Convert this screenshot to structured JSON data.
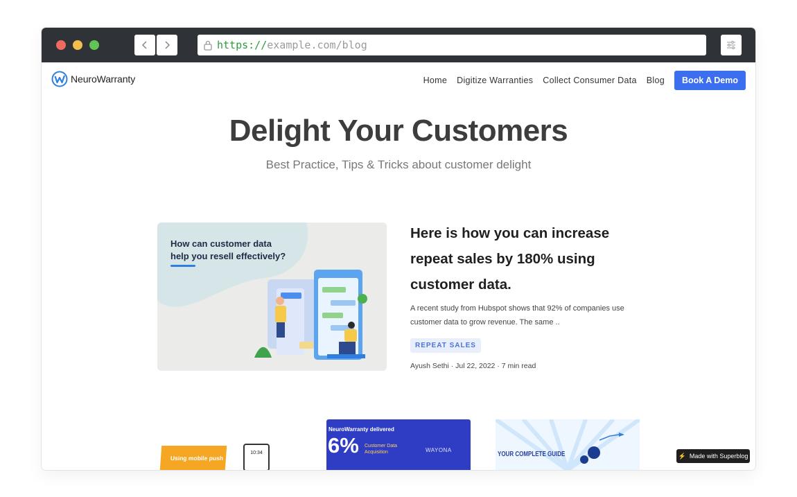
{
  "browser": {
    "url_scheme": "https://",
    "url_rest": "example.com/blog"
  },
  "header": {
    "logo_text": "NeuroWarranty",
    "nav": [
      "Home",
      "Digitize Warranties",
      "Collect Consumer Data",
      "Blog"
    ],
    "cta_label": "Book A Demo"
  },
  "hero": {
    "title": "Delight Your Customers",
    "subtitle": "Best Practice, Tips & Tricks about customer delight"
  },
  "featured_post": {
    "image_text_line1": "How can customer data",
    "image_text_line2": "help you resell effectively?",
    "title": "Here is how you can increase repeat sales by 180% using customer data.",
    "excerpt": "A recent study from Hubspot shows that 92% of companies use customer data to grow revenue. The same ..",
    "tag": "REPEAT SALES",
    "meta": "Ayush Sethi · Jul 22, 2022 · 7 min read"
  },
  "cards": [
    {
      "banner_text": "Using mobile push",
      "phone_time": "10:34"
    },
    {
      "headline": "NeuroWarranty delivered",
      "big_value": "6%",
      "sub_text": "Customer Data Acquisition",
      "brand": "WAYONA"
    },
    {
      "headline": "YOUR COMPLETE GUIDE"
    }
  ],
  "badge": {
    "label": "Made with Superblog"
  },
  "colors": {
    "accent": "#3b6ff0",
    "chrome": "#2f3337",
    "tag_bg": "#e8eefb",
    "tag_text": "#4a74d9"
  }
}
